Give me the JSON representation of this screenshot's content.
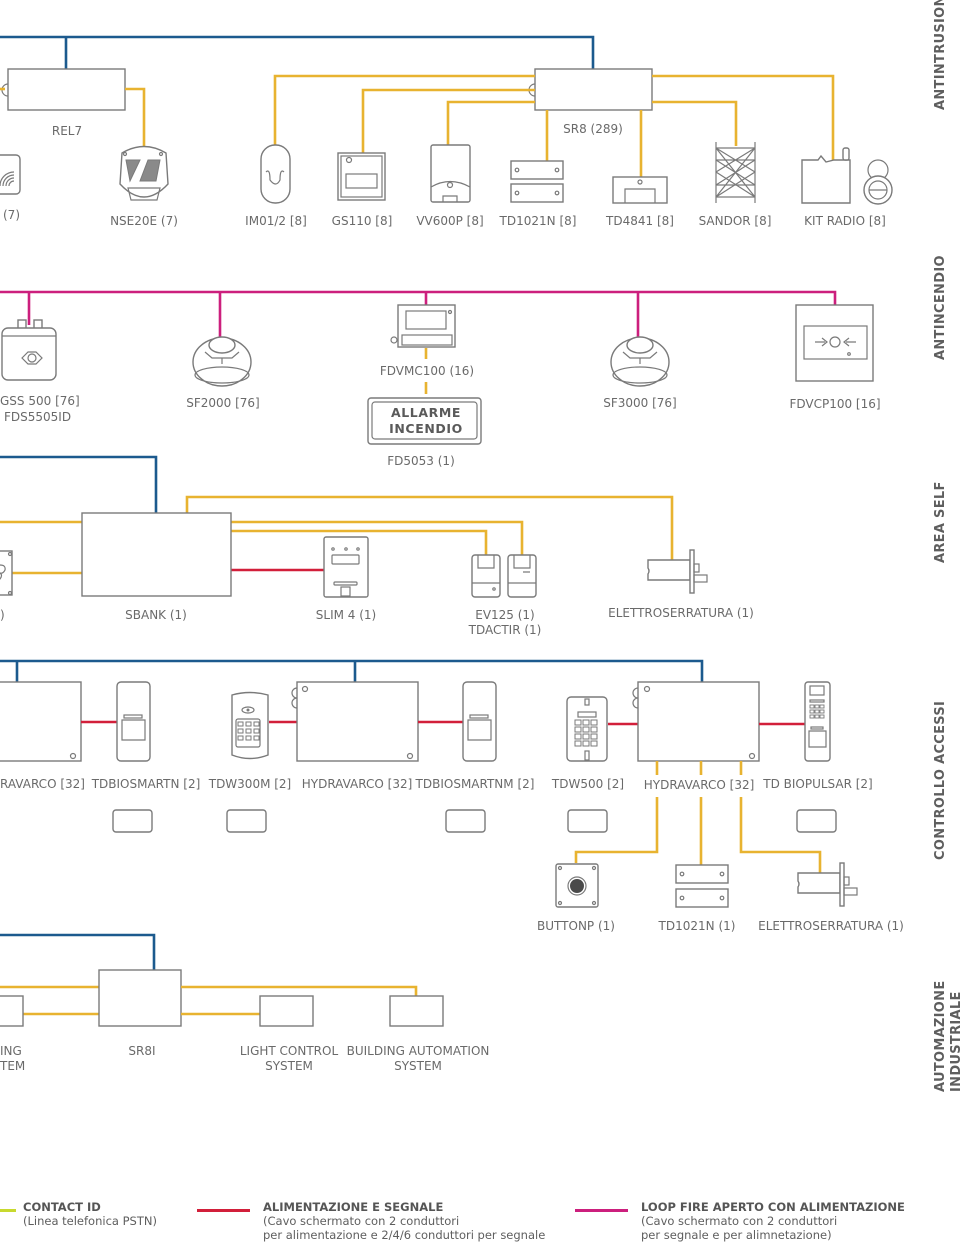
{
  "sections": {
    "antintrusione": "ANTINTRUSIONE",
    "antincendio": "ANTINCENDIO",
    "area_self": "AREA SELF",
    "controllo_accessi": "CONTROLLO ACCESSI",
    "automazione_line1": "AUTOMAZIONE",
    "automazione_line2": "INDUSTRIALE"
  },
  "antintrusione": {
    "rel7": "REL7",
    "sr8": "SR8 (289)",
    "cut_left": "(7)",
    "nse20e": "NSE20E (7)",
    "im01": "IM01/2 [8]",
    "gs110": "GS110 [8]",
    "vv600p": "VV600P [8]",
    "td1021n": "TD1021N [8]",
    "td4841": "TD4841 [8]",
    "sandor": "SANDOR [8]",
    "kit_radio": "KIT RADIO [8]"
  },
  "antincendio": {
    "gss_line1": "GSS 500 [76]",
    "gss_line2": "FDS5505ID",
    "sf2000": "SF2000 [76]",
    "fdvmc100": "FDVMC100 (16)",
    "alarm_line1": "ALLARME",
    "alarm_line2": "INCENDIO",
    "fd5053": "FD5053 (1)",
    "sf3000": "SF3000 [76]",
    "fdvcp100": "FDVCP100 [16]"
  },
  "area_self": {
    "cut_left": ")",
    "sbank": "SBANK (1)",
    "slim4": "SLIM 4 (1)",
    "ev125": "EV125 (1)",
    "tdactir": "TDACTIR (1)",
    "elettroserratura": "ELETTROSERRATURA (1)"
  },
  "controllo_accessi": {
    "hydravarco_left": "RAVARCO [32]",
    "tdbiosmartn": "TDBIOSMARTN [2]",
    "tdw300m": "TDW300M [2]",
    "hydravarco_mid": "HYDRAVARCO [32]",
    "tdbiosmartnm": "TDBIOSMARTNM [2]",
    "tdw500": "TDW500 [2]",
    "hydravarco_right": "HYDRAVARCO [32]",
    "td_biopulsar": "TD BIOPULSAR [2]",
    "buttonp": "BUTTONP (1)",
    "td1021n": "TD1021N (1)",
    "elettroserratura": "ELETTROSERRATURA (1)"
  },
  "automazione": {
    "cut_line1": "ING",
    "cut_line2": "TEM",
    "sr8i": "SR8I",
    "light_line1": "LIGHT CONTROL",
    "light_line2": "SYSTEM",
    "bas_line1": "BUILDING AUTOMATION",
    "bas_line2": "SYSTEM"
  },
  "legend": [
    {
      "title": "CONTACT ID",
      "line1": "(Linea telefonica PSTN)",
      "line2": "",
      "color": "#c8d92e"
    },
    {
      "title": "ALIMENTAZIONE E SEGNALE",
      "line1": "(Cavo schermato con 2 conduttori",
      "line2": "per alimentazione e 2/4/6 conduttori per segnale",
      "color": "#d21f3a"
    },
    {
      "title": "LOOP FIRE APERTO CON ALIMENTAZIONE",
      "line1": "(Cavo schermato con 2 conduttori",
      "line2": "per segnale e per alimnetazione)",
      "color": "#cc1f7d"
    }
  ],
  "colors": {
    "bus_blue": "#1c5a8e",
    "signal_yellow": "#e8b330",
    "power_red": "#d21f3a",
    "fire_magenta": "#cc1f7d",
    "device_gray": "#7a7a7a"
  }
}
